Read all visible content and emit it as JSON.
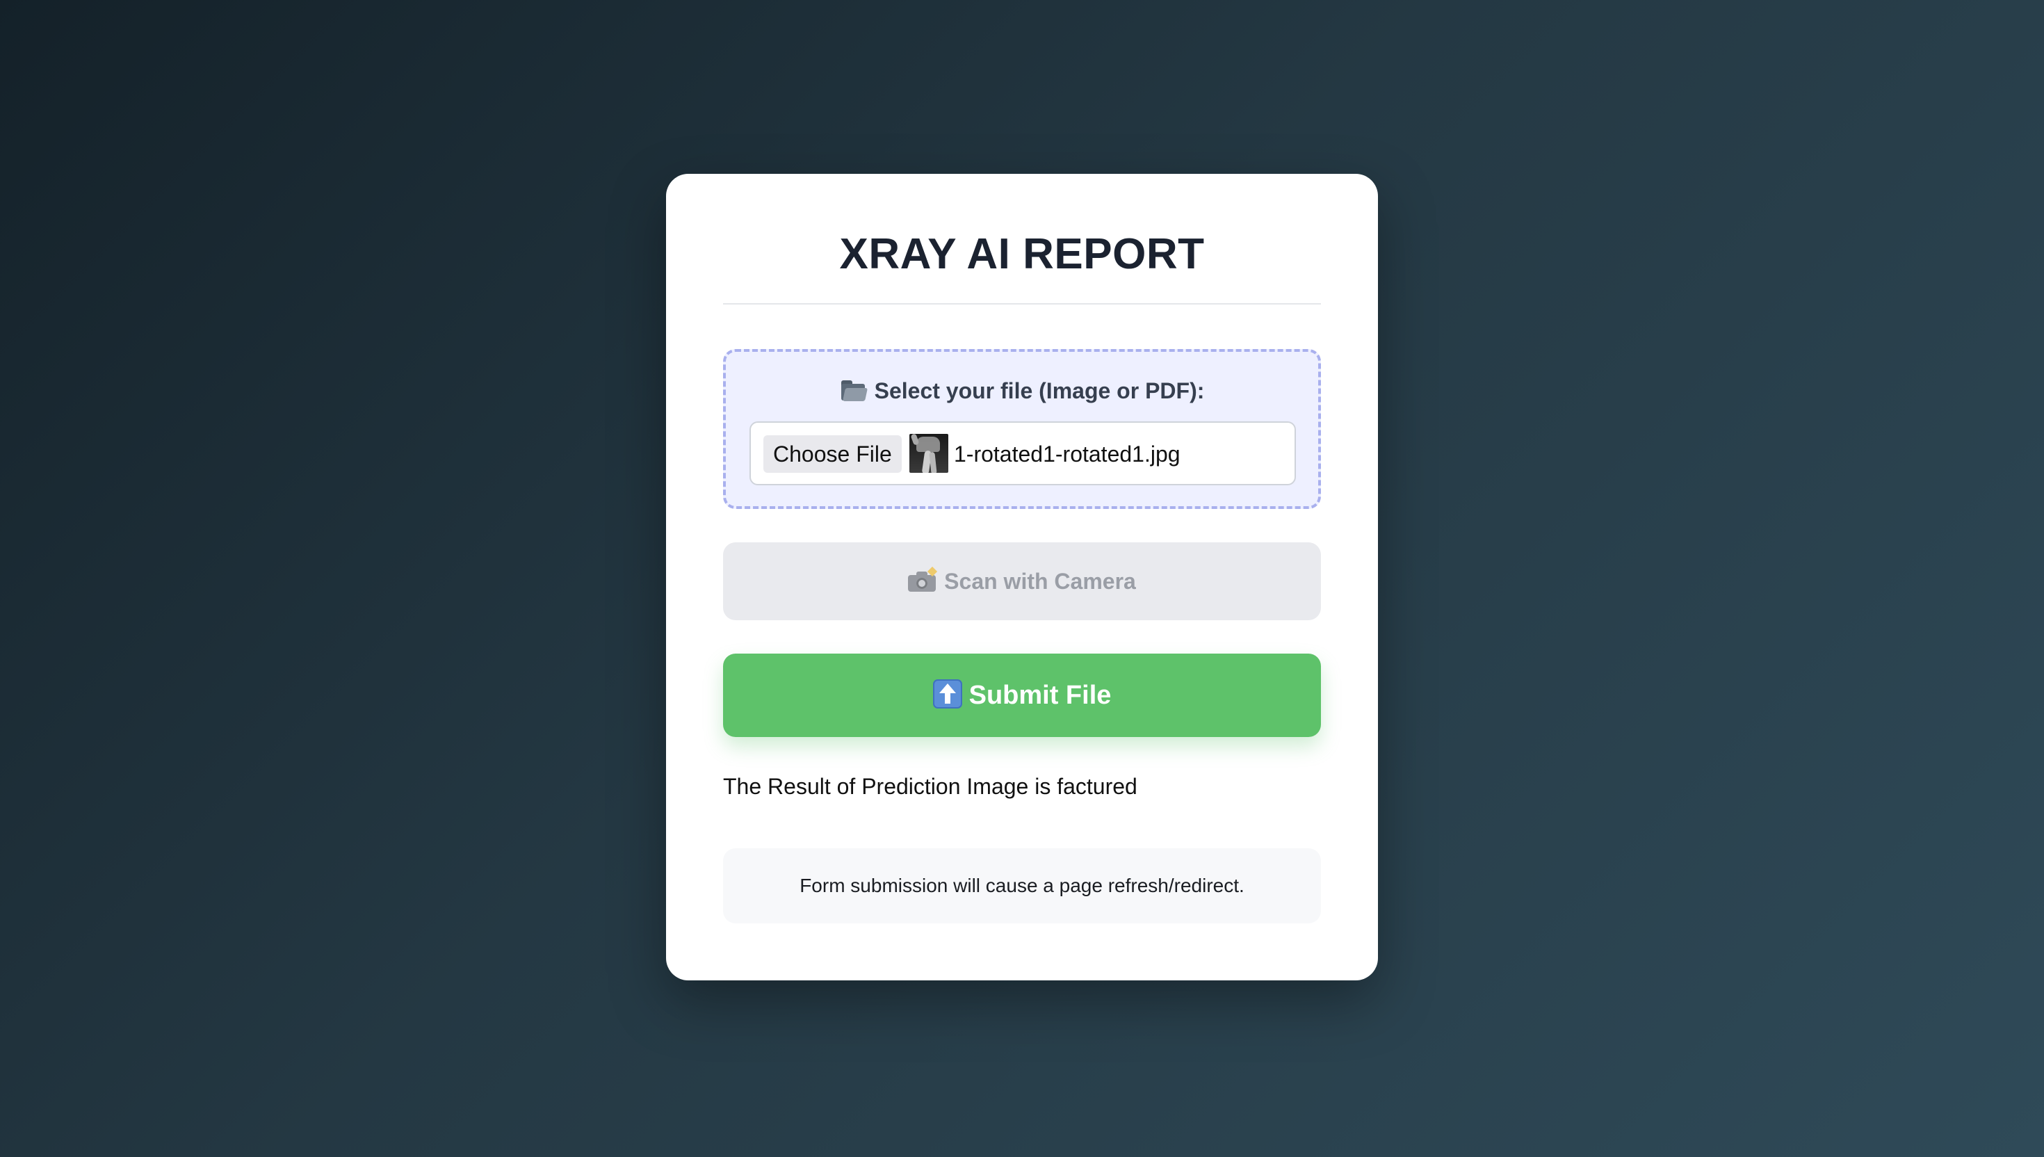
{
  "card": {
    "title": "XRAY AI REPORT"
  },
  "upload": {
    "label": "Select your file (Image or PDF):",
    "label_icon": "folder-icon",
    "choose_button_label": "Choose File",
    "selected_file_name": "1-rotated1-rotated1.jpg",
    "thumbnail_icon": "xray-thumbnail"
  },
  "camera_button": {
    "label": "Scan with Camera",
    "icon": "camera-flash-icon",
    "enabled": false
  },
  "submit_button": {
    "label": "Submit File",
    "icon": "up-arrow-icon"
  },
  "result": {
    "text": "The Result of Prediction Image is factured"
  },
  "note": {
    "text": "Form submission will cause a page refresh/redirect."
  },
  "colors": {
    "submit_green": "#5ec26a",
    "upload_zone_bg": "#eef0ff",
    "upload_zone_border": "#a9b0ee",
    "disabled_button_bg": "#e9eaee",
    "title_color": "#1b2230"
  }
}
